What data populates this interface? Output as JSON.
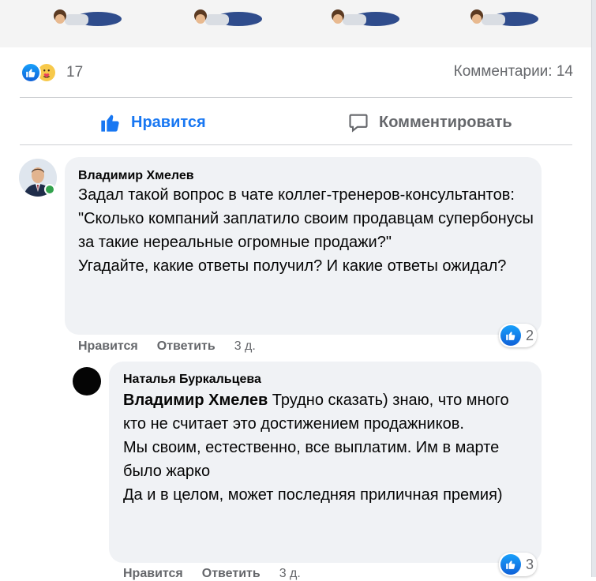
{
  "reactions": {
    "count": "17"
  },
  "comments_summary": "Комментарии: 14",
  "actions": {
    "like": "Нравится",
    "comment": "Комментировать"
  },
  "comments": [
    {
      "author": "Владимир Хмелев",
      "text": "Задал такой вопрос в чате коллег-тренеров-консультантов: \"Сколько компаний заплатило своим продавцам супербонусы за такие нереальные огромные продажи?\"\nУгадайте, какие ответы получил? И какие ответы ожидал?",
      "reaction_count": "2",
      "like_label": "Нравится",
      "reply_label": "Ответить",
      "time": "3 д."
    },
    {
      "author": "Наталья Буркальцева",
      "mention": "Владимир Хмелев",
      "text": " Трудно сказать) знаю, что много кто не считает это достижением продажников.\nМы своим, естественно, все выплатим. Им в марте было жарко\nДа и в целом, может последняя приличная премия)",
      "reaction_count": "3",
      "like_label": "Нравится",
      "reply_label": "Ответить",
      "time": "3 д."
    }
  ],
  "colors": {
    "accent": "#1877f2",
    "muted": "#65676b",
    "bubble": "#f0f2f5",
    "online": "#31a24c"
  },
  "icons": [
    "like-icon",
    "care-icon",
    "thumbs-up-icon",
    "comment-icon"
  ]
}
